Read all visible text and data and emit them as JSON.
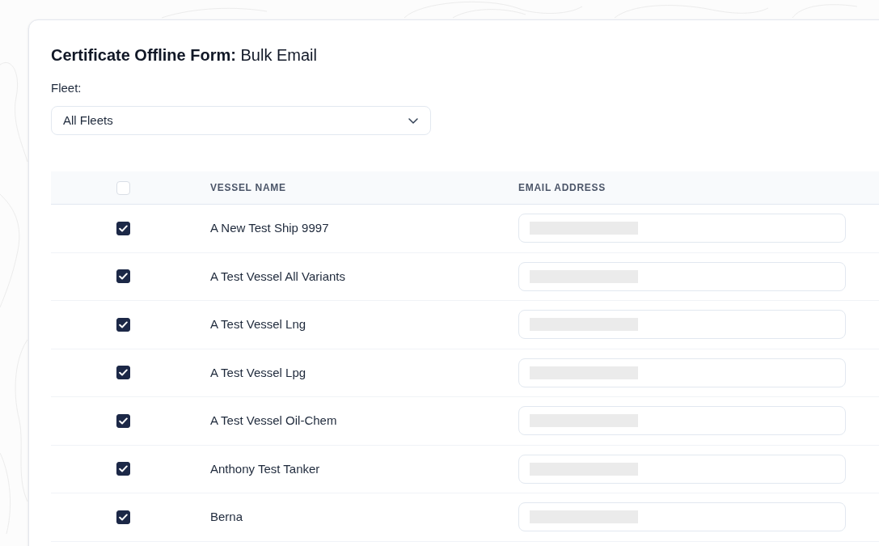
{
  "form": {
    "title": "**Certificate Offline Form:** Bulk Email"
  },
  "fleet_filter": {
    "label": "Fleet:",
    "value": "All Fleets"
  },
  "table": {
    "select_all": {
      "checked": false
    },
    "columns": [
      "VESSEL NAME",
      "EMAIL ADDRESS"
    ],
    "rows": [
      {
        "vessel_name": "A New Test Ship 9997",
        "checked": true,
        "email_redacted": true
      },
      {
        "vessel_name": "A Test Vessel All Variants",
        "checked": true,
        "email_redacted": true
      },
      {
        "vessel_name": "A Test Vessel Lng",
        "checked": true,
        "email_redacted": true
      },
      {
        "vessel_name": "A Test Vessel Lpg",
        "checked": true,
        "email_redacted": true
      },
      {
        "vessel_name": "A Test Vessel Oil-Chem",
        "checked": true,
        "email_redacted": true
      },
      {
        "vessel_name": "Anthony Test Tanker",
        "checked": true,
        "email_redacted": true
      },
      {
        "vessel_name": "Berna",
        "checked": true,
        "email_redacted": true
      }
    ]
  }
}
